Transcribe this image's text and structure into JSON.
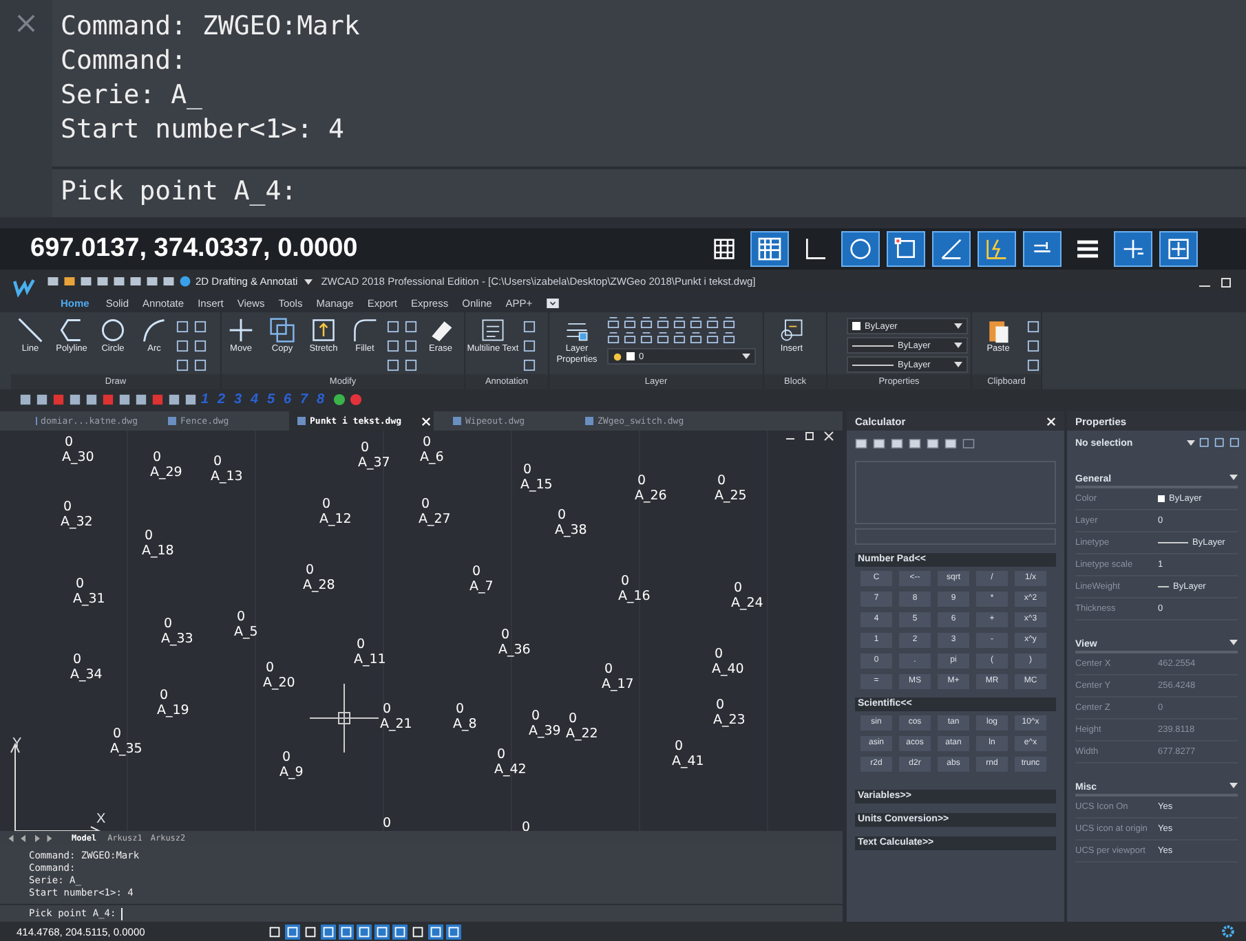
{
  "zoom_command_line": {
    "lines": [
      "Command: ZWGEO:Mark",
      "Command:",
      "Serie: A_",
      "Start number<1>: 4"
    ],
    "prompt": "Pick point A_4:"
  },
  "zoom_status_bar": {
    "coordinates": "697.0137, 374.0337, 0.0000",
    "toggles": [
      {
        "on": false
      },
      {
        "on": true
      },
      {
        "on": false
      },
      {
        "on": true
      },
      {
        "on": true
      },
      {
        "on": true
      },
      {
        "on": true
      },
      {
        "on": true
      },
      {
        "on": false
      },
      {
        "on": true
      },
      {
        "on": true
      }
    ]
  },
  "title_bar": {
    "workspace": "2D Drafting & Annotati",
    "title": "ZWCAD 2018 Professional Edition - [C:\\Users\\izabela\\Desktop\\ZWGeo 2018\\Punkt i tekst.dwg]"
  },
  "ribbon_tabs": [
    {
      "label": "Home",
      "selected": true
    },
    {
      "label": "Solid",
      "selected": false
    },
    {
      "label": "Annotate",
      "selected": false
    },
    {
      "label": "Insert",
      "selected": false
    },
    {
      "label": "Views",
      "selected": false
    },
    {
      "label": "Tools",
      "selected": false
    },
    {
      "label": "Manage",
      "selected": false
    },
    {
      "label": "Export",
      "selected": false
    },
    {
      "label": "Express",
      "selected": false
    },
    {
      "label": "Online",
      "selected": false
    },
    {
      "label": "APP+",
      "selected": false
    }
  ],
  "ribbon": {
    "draw": {
      "title": "Draw",
      "tools": [
        "Line",
        "Polyline",
        "Circle",
        "Arc"
      ]
    },
    "modify": {
      "title": "Modify",
      "tools": [
        "Move",
        "Copy",
        "Stretch",
        "Fillet"
      ],
      "erase": "Erase"
    },
    "annotation": {
      "title": "Annotation",
      "tool": "Multiline Text"
    },
    "layer": {
      "title": "Layer",
      "tool": "Layer Properties",
      "current": "0"
    },
    "block": {
      "title": "Block",
      "tool": "Insert"
    },
    "properties": {
      "title": "Properties",
      "color_setting": "ByLayer",
      "linetype": "ByLayer",
      "lineweight": "ByLayer"
    },
    "clipboard": {
      "title": "Clipboard",
      "tool": "Paste"
    }
  },
  "custom_toolbar": {
    "numbers": [
      "1",
      "2",
      "3",
      "4",
      "5",
      "6",
      "7",
      "8"
    ]
  },
  "document_tabs": [
    {
      "label": "domiar...katne.dwg",
      "selected": false
    },
    {
      "label": "Fence.dwg",
      "selected": false
    },
    {
      "label": "Punkt i tekst.dwg",
      "selected": true
    },
    {
      "label": "Wipeout.dwg",
      "selected": false
    },
    {
      "label": "ZWgeo_switch.dwg",
      "selected": false
    }
  ],
  "drawing": {
    "points": [
      {
        "value": "0",
        "label": "A_30"
      },
      {
        "value": "0",
        "label": "A_29"
      },
      {
        "value": "0",
        "label": "A_13"
      },
      {
        "value": "0",
        "label": "A_37"
      },
      {
        "value": "0",
        "label": "A_6"
      },
      {
        "value": "0",
        "label": "A_15"
      },
      {
        "value": "0",
        "label": "A_26"
      },
      {
        "value": "0",
        "label": "A_25"
      },
      {
        "value": "0",
        "label": "A_32"
      },
      {
        "value": "0",
        "label": "A_12"
      },
      {
        "value": "0",
        "label": "A_27"
      },
      {
        "value": "0",
        "label": "A_38"
      },
      {
        "value": "0",
        "label": "A_18"
      },
      {
        "value": "0",
        "label": "A_28"
      },
      {
        "value": "0",
        "label": "A_7"
      },
      {
        "value": "0",
        "label": "A_16"
      },
      {
        "value": "0",
        "label": "A_24"
      },
      {
        "value": "0",
        "label": "A_31"
      },
      {
        "value": "0",
        "label": "A_33"
      },
      {
        "value": "0",
        "label": "A_5"
      },
      {
        "value": "0",
        "label": "A_36"
      },
      {
        "value": "0",
        "label": "A_11"
      },
      {
        "value": "0",
        "label": "A_40"
      },
      {
        "value": "0",
        "label": "A_34"
      },
      {
        "value": "0",
        "label": "A_20"
      },
      {
        "value": "0",
        "label": "A_17"
      },
      {
        "value": "0",
        "label": "A_19"
      },
      {
        "value": "0",
        "label": "A_21"
      },
      {
        "value": "0",
        "label": "A_8"
      },
      {
        "value": "0",
        "label": "A_39"
      },
      {
        "value": "0",
        "label": "A_22"
      },
      {
        "value": "0",
        "label": "A_23"
      },
      {
        "value": "0",
        "label": "A_35"
      },
      {
        "value": "0",
        "label": "A_41"
      },
      {
        "value": "0",
        "label": "A_9"
      },
      {
        "value": "0",
        "label": "A_42"
      }
    ],
    "unlabeled_points": [
      "0",
      "0"
    ],
    "axis_y": "Y",
    "axis_x": "X"
  },
  "layout_tabs": [
    {
      "label": "Model",
      "selected": true
    },
    {
      "label": "Arkusz1",
      "selected": false
    },
    {
      "label": "Arkusz2",
      "selected": false
    }
  ],
  "command_line": {
    "lines": [
      "Command: ZWGEO:Mark",
      "Command:",
      "Serie: A_",
      "Start number<1>: 4"
    ],
    "prompt": "Pick point A_4:"
  },
  "status_bar": {
    "coordinates": "414.4768, 204.5115, 0.0000",
    "toggles": [
      {
        "on": false
      },
      {
        "on": true
      },
      {
        "on": false
      },
      {
        "on": true
      },
      {
        "on": true
      },
      {
        "on": true
      },
      {
        "on": true
      },
      {
        "on": true
      },
      {
        "on": false
      },
      {
        "on": true
      },
      {
        "on": true
      }
    ]
  },
  "calculator": {
    "title": "Calculator",
    "number_pad": {
      "title": "Number Pad<<",
      "keys": [
        "C",
        "<--",
        "sqrt",
        "/",
        "1/x",
        "7",
        "8",
        "9",
        "*",
        "x^2",
        "4",
        "5",
        "6",
        "+",
        "x^3",
        "1",
        "2",
        "3",
        "-",
        "x^y",
        "0",
        ".",
        "pi",
        "(",
        ")",
        "=",
        "MS",
        "M+",
        "MR",
        "MC"
      ]
    },
    "scientific": {
      "title": "Scientific<<",
      "keys": [
        "sin",
        "cos",
        "tan",
        "log",
        "10^x",
        "asin",
        "acos",
        "atan",
        "ln",
        "e^x",
        "r2d",
        "d2r",
        "abs",
        "rnd",
        "trunc"
      ]
    },
    "sections": [
      "Variables>>",
      "Units Conversion>>",
      "Text Calculate>>"
    ]
  },
  "properties": {
    "title": "Properties",
    "selection": "No selection",
    "groups": [
      {
        "title": "General",
        "rows": [
          {
            "label": "Color",
            "value": "ByLayer",
            "kind": "swatch"
          },
          {
            "label": "Layer",
            "value": "0",
            "kind": "text"
          },
          {
            "label": "Linetype",
            "value": "ByLayer",
            "kind": "line"
          },
          {
            "label": "Linetype scale",
            "value": "1",
            "kind": "text"
          },
          {
            "label": "LineWeight",
            "value": "ByLayer",
            "kind": "short-line"
          },
          {
            "label": "Thickness",
            "value": "0",
            "kind": "text"
          }
        ]
      },
      {
        "title": "View",
        "rows": [
          {
            "label": "Center X",
            "value": "462.2554",
            "kind": "dim"
          },
          {
            "label": "Center Y",
            "value": "256.4248",
            "kind": "dim"
          },
          {
            "label": "Center Z",
            "value": "0",
            "kind": "dim"
          },
          {
            "label": "Height",
            "value": "239.8118",
            "kind": "dim"
          },
          {
            "label": "Width",
            "value": "677.8277",
            "kind": "dim"
          }
        ]
      },
      {
        "title": "Misc",
        "rows": [
          {
            "label": "UCS Icon On",
            "value": "Yes",
            "kind": "text"
          },
          {
            "label": "UCS icon at origin",
            "value": "Yes",
            "kind": "text"
          },
          {
            "label": "UCS per viewport",
            "value": "Yes",
            "kind": "text"
          }
        ]
      }
    ]
  }
}
